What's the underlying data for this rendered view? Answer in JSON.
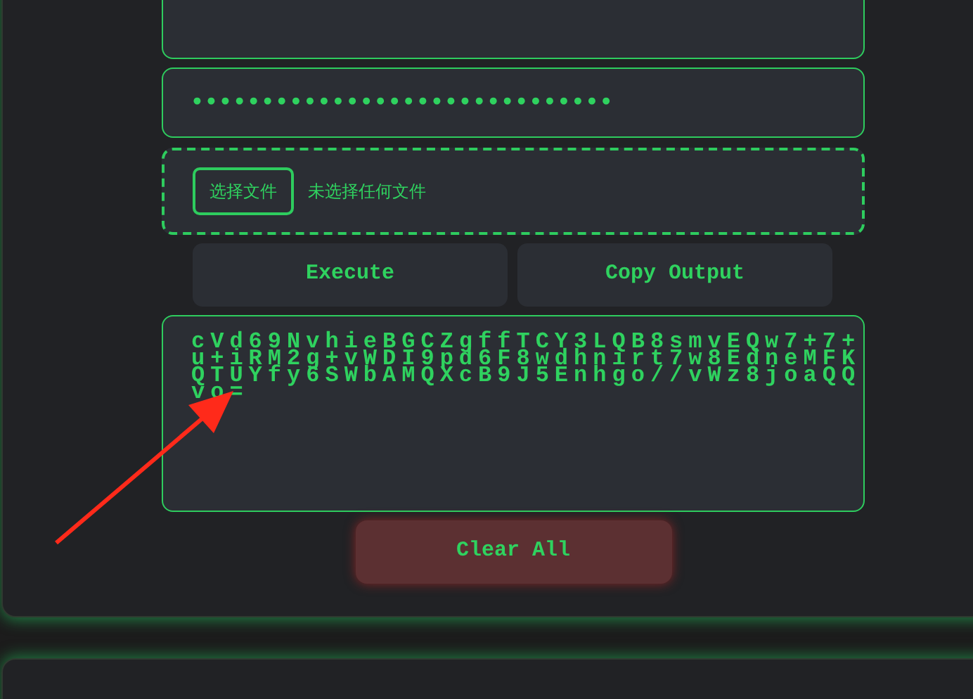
{
  "password_field": {
    "value": "••••••••••••••••••••••••••••••"
  },
  "file_picker": {
    "button": "选择文件",
    "status": "未选择任何文件"
  },
  "buttons": [
    {
      "label": "Execute"
    },
    {
      "label": "Copy Output"
    }
  ],
  "output": {
    "value": "cVd69NvhieBGCZgffTCY3LQB8smvEQw7+7+u+iRM2g+vWDI9pd6F8wdhnirt7w8EdneMFKQTUYfy6SWbAMQXcB9J5Enhgo//vWz8joaQQvo="
  },
  "clear_button": {
    "label": "Clear All"
  }
}
